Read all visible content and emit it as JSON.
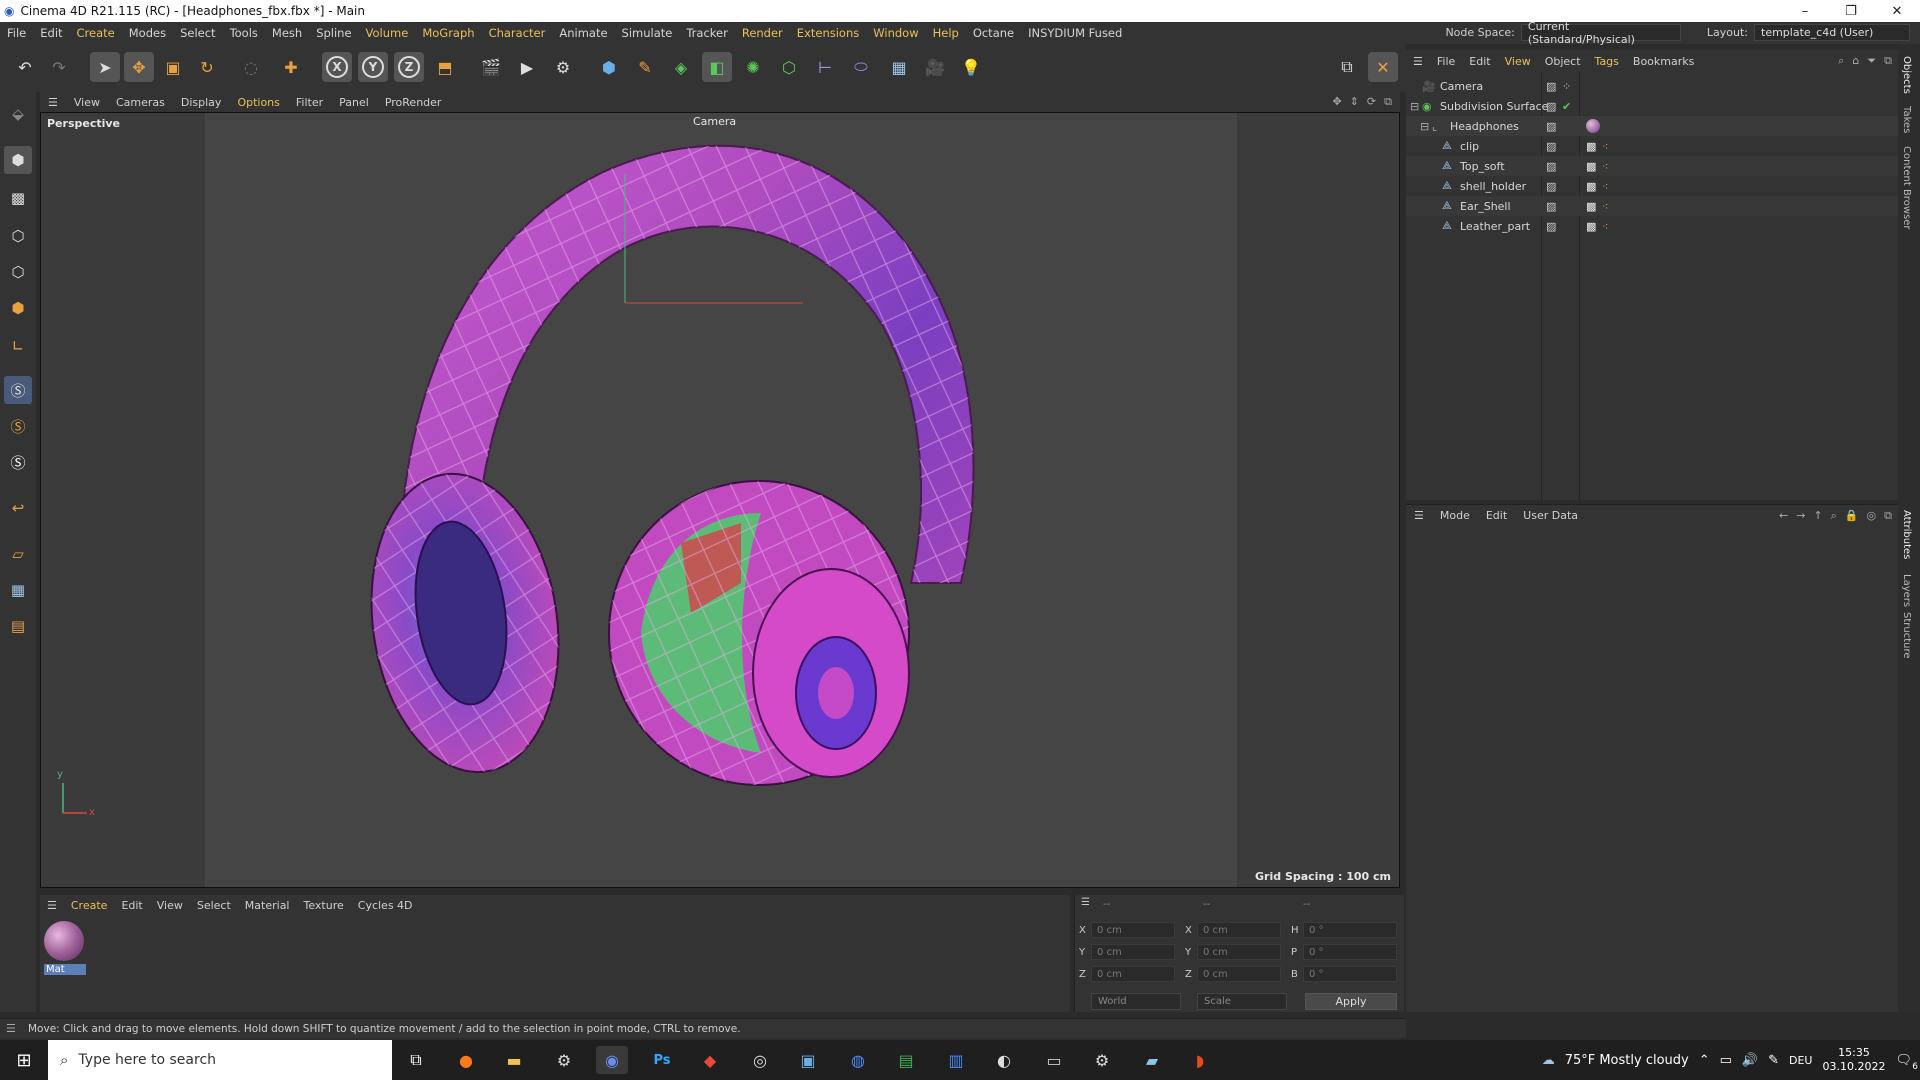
{
  "window": {
    "title": "Cinema 4D R21.115 (RC) - [Headphones_fbx.fbx *] - Main",
    "controls": [
      "–",
      "❐",
      "✕"
    ]
  },
  "menubar": {
    "items": [
      "File",
      "Edit",
      "Create",
      "Modes",
      "Select",
      "Tools",
      "Mesh",
      "Spline",
      "Volume",
      "MoGraph",
      "Character",
      "Animate",
      "Simulate",
      "Tracker",
      "Render",
      "Extensions",
      "Window",
      "Help",
      "Octane",
      "INSYDIUM Fused"
    ],
    "node_space_label": "Node Space:",
    "node_space_value": "Current (Standard/Physical)",
    "layout_label": "Layout:",
    "layout_value": "template_c4d (User)"
  },
  "toolbar": {
    "axis_x": "X",
    "axis_y": "Y",
    "axis_z": "Z"
  },
  "viewport": {
    "menu": [
      "View",
      "Cameras",
      "Display",
      "Options",
      "Filter",
      "Panel",
      "ProRender"
    ],
    "label": "Perspective",
    "camera_label": "Camera",
    "grid_spacing": "Grid Spacing : 100 cm",
    "axis_y": "y",
    "axis_x": "x"
  },
  "object_manager": {
    "menu": [
      "File",
      "Edit",
      "View",
      "Object",
      "Tags",
      "Bookmarks"
    ],
    "objects": [
      {
        "name": "Camera"
      },
      {
        "name": "Subdivision Surface"
      },
      {
        "name": "Headphones"
      },
      {
        "name": "clip"
      },
      {
        "name": "Top_soft"
      },
      {
        "name": "shell_holder"
      },
      {
        "name": "Ear_Shell"
      },
      {
        "name": "Leather_part"
      }
    ]
  },
  "attribute_manager": {
    "menu": [
      "Mode",
      "Edit",
      "User Data"
    ]
  },
  "right_tabs": [
    "Objects",
    "Takes",
    "Content Browser",
    "Attributes",
    "Layers",
    "Structure"
  ],
  "material_manager": {
    "menu": [
      "Create",
      "Edit",
      "View",
      "Select",
      "Material",
      "Texture",
      "Cycles 4D"
    ],
    "material_name": "Mat"
  },
  "coordinates": {
    "header": [
      "--",
      "--",
      "--"
    ],
    "rows": [
      {
        "a": "X",
        "av": "0 cm",
        "b": "X",
        "bv": "0 cm",
        "c": "H",
        "cv": "0 °"
      },
      {
        "a": "Y",
        "av": "0 cm",
        "b": "Y",
        "bv": "0 cm",
        "c": "P",
        "cv": "0 °"
      },
      {
        "a": "Z",
        "av": "0 cm",
        "b": "Z",
        "bv": "0 cm",
        "c": "B",
        "cv": "0 °"
      }
    ],
    "mode1": "World",
    "mode2": "Scale",
    "apply": "Apply"
  },
  "status_text": "Move: Click and drag to move elements. Hold down SHIFT to quantize movement / add to the selection in point mode, CTRL to remove.",
  "taskbar": {
    "search_placeholder": "Type here to search",
    "weather": "75°F  Mostly cloudy",
    "lang": "DEU",
    "time": "15:35",
    "date": "03.10.2022",
    "notif_count": "6"
  },
  "colors": {
    "accent": "#e8c15a",
    "selection": "#5d7fb8"
  }
}
